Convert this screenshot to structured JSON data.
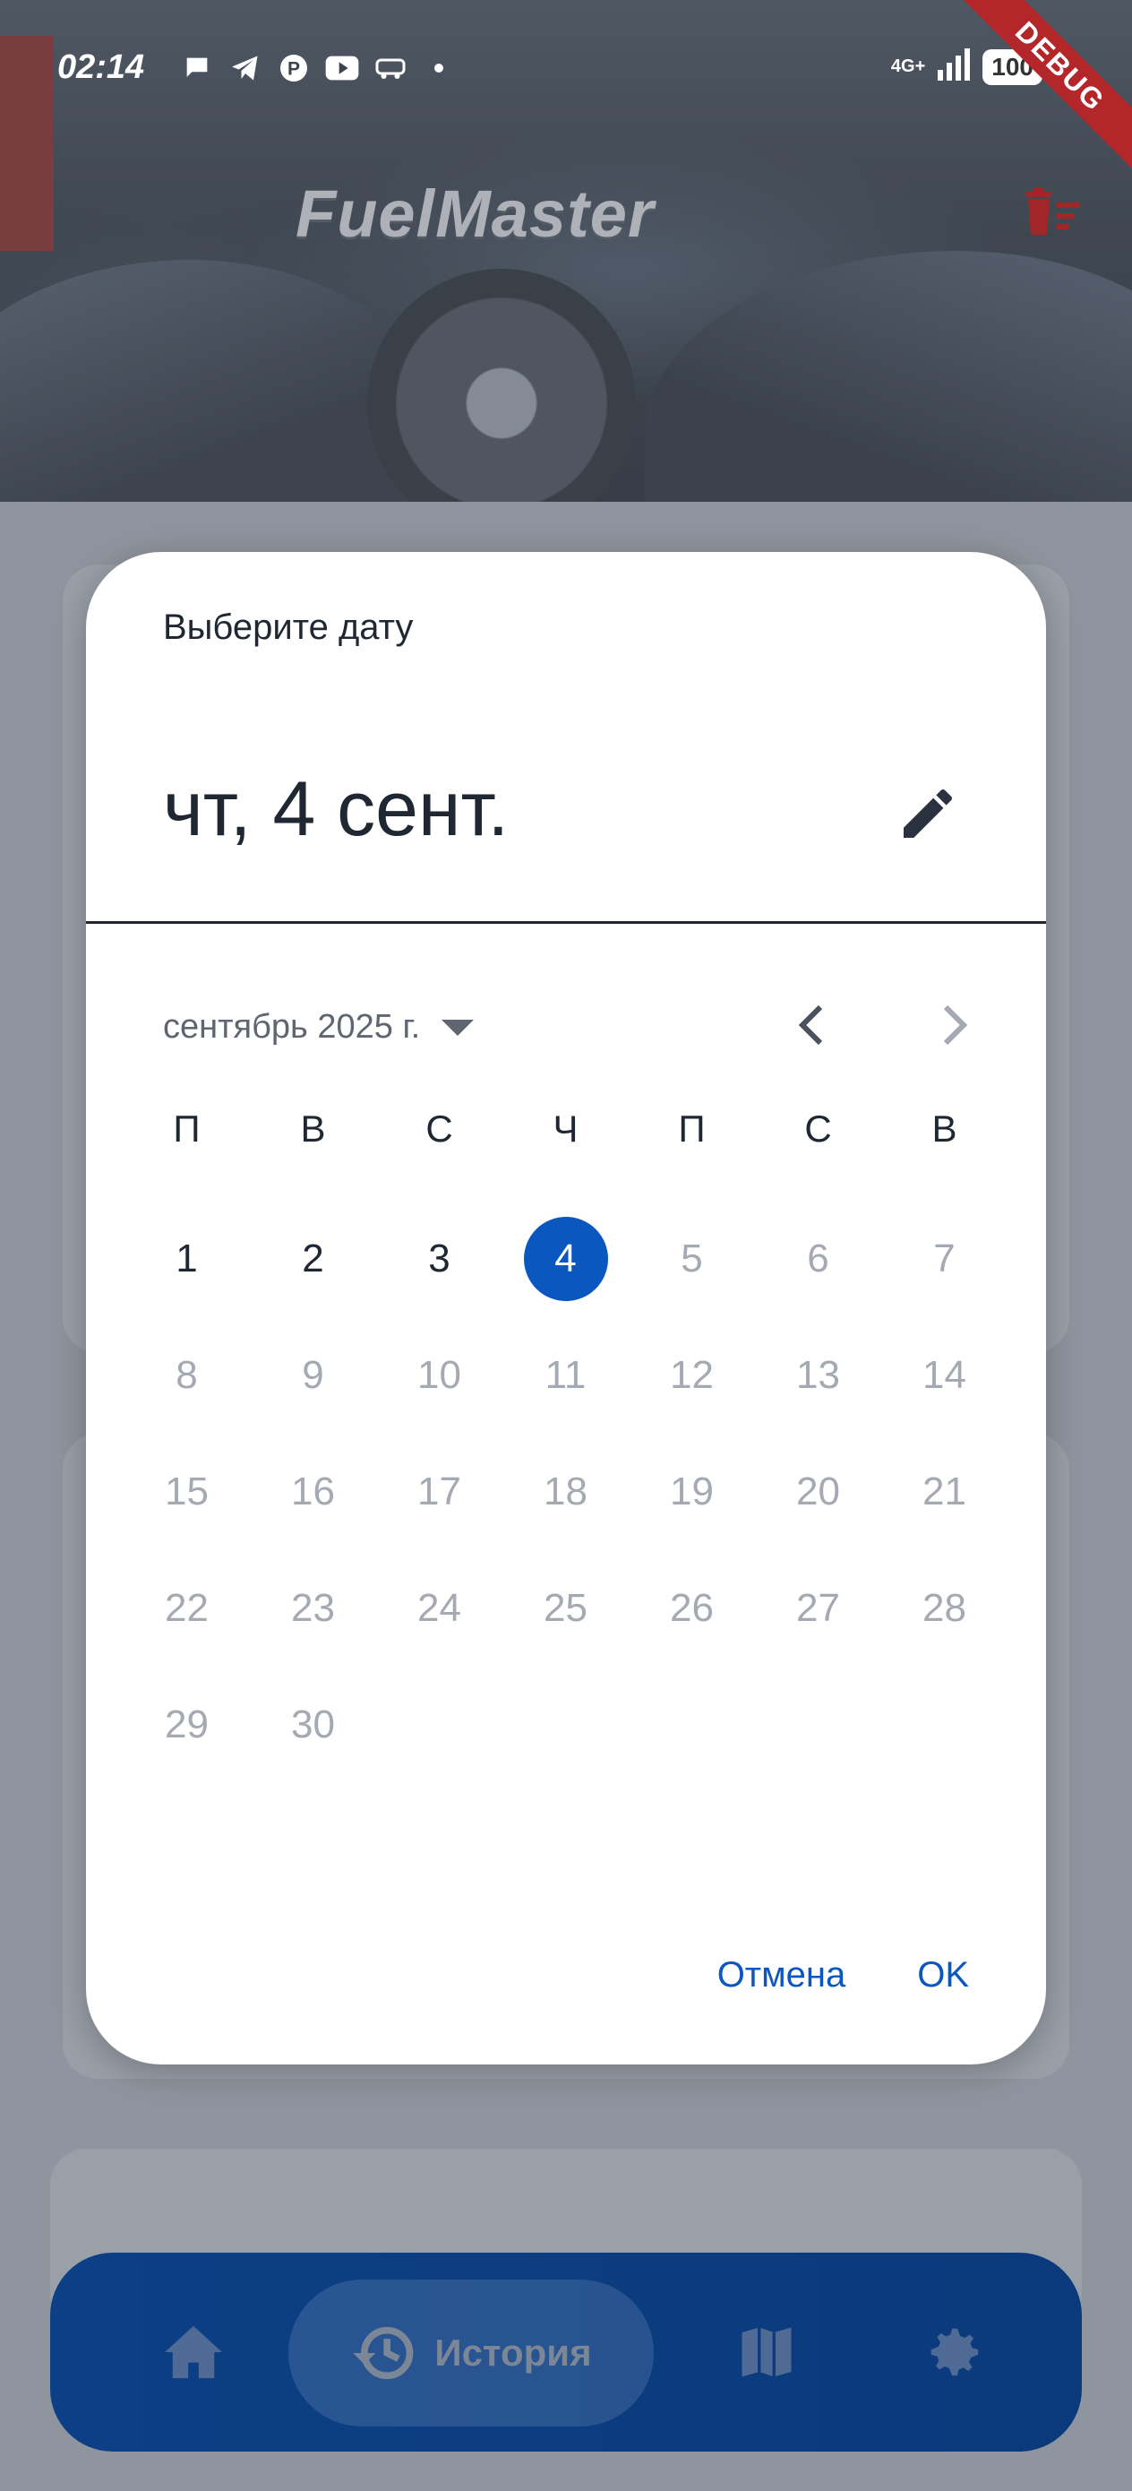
{
  "status": {
    "time": "02:14",
    "network": "4G+",
    "battery": "100"
  },
  "header": {
    "logo": "FuelMaster",
    "debug_banner": "DEBUG",
    "trash_icon": "delete-sweep-icon"
  },
  "dialog": {
    "title": "Выберите дату",
    "selected_date": "чт, 4 сент.",
    "month_label": "сентябрь 2025 г.",
    "weekdays": [
      "П",
      "В",
      "С",
      "Ч",
      "П",
      "С",
      "В"
    ],
    "days": [
      "1",
      "2",
      "3",
      "4",
      "5",
      "6",
      "7",
      "8",
      "9",
      "10",
      "11",
      "12",
      "13",
      "14",
      "15",
      "16",
      "17",
      "18",
      "19",
      "20",
      "21",
      "22",
      "23",
      "24",
      "25",
      "26",
      "27",
      "28",
      "29",
      "30"
    ],
    "selected_day": 4,
    "last_enabled_day": 4,
    "cancel_label": "Отмена",
    "ok_label": "OK",
    "accent_color": "#0b57c0"
  },
  "bottom_nav": {
    "active_label": "История",
    "items": [
      "home-icon",
      "history-icon",
      "map-icon",
      "settings-icon"
    ]
  }
}
